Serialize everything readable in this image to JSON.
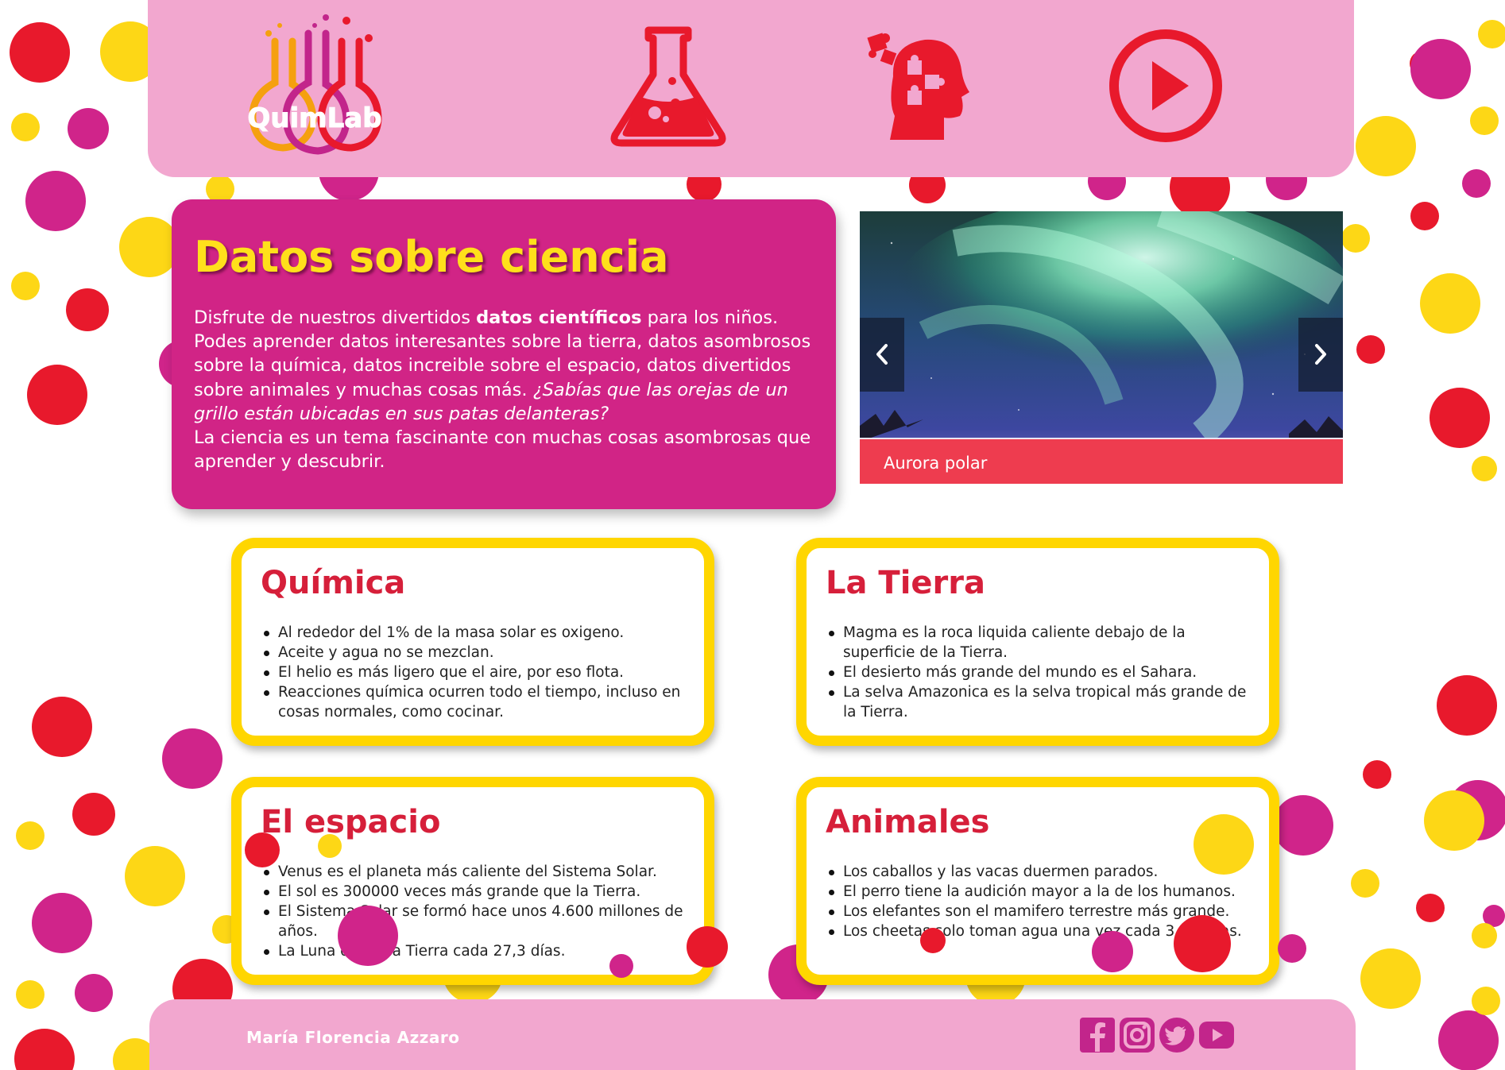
{
  "header": {
    "logo_text": "QuimLab",
    "nav": [
      {
        "icon": "flask-icon"
      },
      {
        "icon": "head-puzzle-icon"
      },
      {
        "icon": "play-icon"
      }
    ]
  },
  "intro": {
    "title": "Datos sobre ciencia",
    "p1_pre": "Disfrute de nuestros divertidos ",
    "p1_bold": "datos científicos",
    "p1_post": " para los niños. Podes aprender datos interesantes sobre la tierra, datos asombrosos sobre la química, datos increible sobre el espacio, datos divertidos sobre animales y muchas cosas más. ",
    "p1_italic": "¿Sabías que las orejas de un grillo están ubicadas en sus patas delanteras?",
    "p2": "La ciencia es un tema fascinante con muchas cosas asombrosas que aprender y descubrir."
  },
  "carousel": {
    "caption": "Aurora polar",
    "prev_icon": "chevron-left-icon",
    "next_icon": "chevron-right-icon"
  },
  "cards": {
    "quimica": {
      "title": "Química",
      "items": [
        "Al rededor del 1% de la masa solar es oxigeno.",
        "Aceite y agua no se mezclan.",
        "El helio es más ligero que el aire, por eso flota.",
        "Reacciones química ocurren todo el tiempo, incluso en cosas normales, como cocinar."
      ]
    },
    "tierra": {
      "title": "La Tierra",
      "items": [
        "Magma es la roca liquida caliente debajo de la superficie de la Tierra.",
        "El desierto más grande del mundo es el Sahara.",
        "La selva Amazonica es la selva tropical más grande de la Tierra."
      ]
    },
    "espacio": {
      "title": "El espacio",
      "items": [
        "Venus es el planeta más caliente del Sistema Solar.",
        "El sol es 300000 veces más grande que la Tierra.",
        "El Sistema Solar se formó hace unos 4.600 millones de años.",
        "La Luna orbita la Tierra cada 27,3 días."
      ]
    },
    "animales": {
      "title": "Animales",
      "items": [
        "Los caballos y las vacas duermen parados.",
        "El perro tiene la audición mayor a la de los humanos.",
        "Los elefantes son el mamifero terrestre más grande.",
        "Los cheetas solo toman agua una vez cada 3 o 4 días."
      ]
    }
  },
  "footer": {
    "author": "María Florencia Azzaro",
    "social": [
      "facebook-icon",
      "instagram-icon",
      "twitter-icon",
      "youtube-icon"
    ]
  },
  "colors": {
    "header_pink": "#f2a7cf",
    "intro_magenta": "#d12486",
    "title_yellow": "#ffe01b",
    "card_border_yellow": "#ffd600",
    "card_title_red": "#d61f3a",
    "dot_red": "#e8192c",
    "dot_magenta": "#d0248a",
    "dot_yellow": "#fdd716"
  }
}
